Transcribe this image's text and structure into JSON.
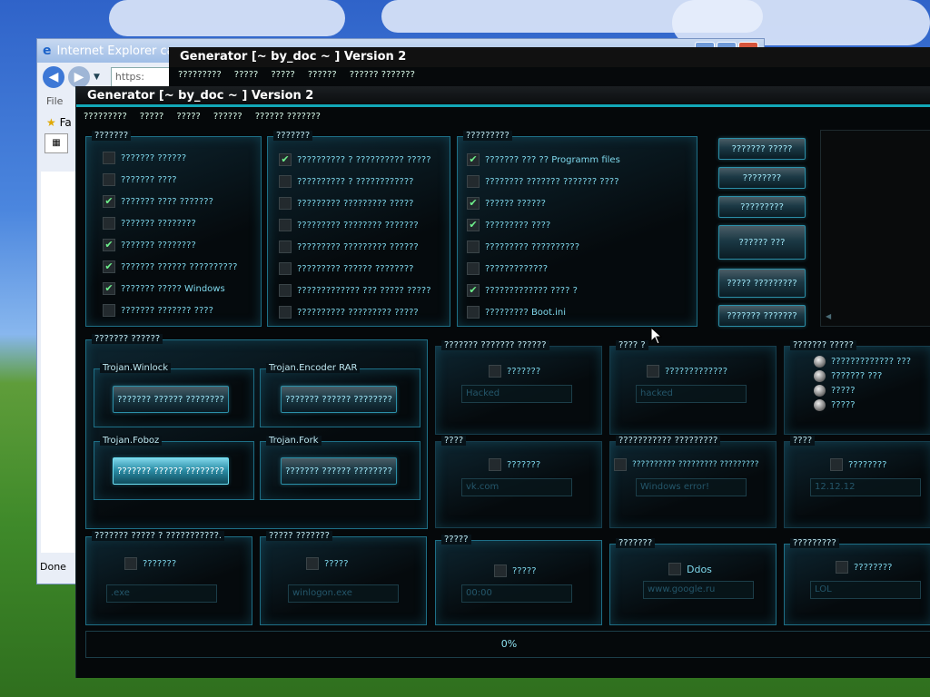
{
  "ie": {
    "title": "Internet Explorer ca",
    "address": "https:",
    "menu_file": "File",
    "favorites": "Fa",
    "status": "Done"
  },
  "gen_back": {
    "title": "Generator [~ by_doc ~ ] Version 2",
    "menu": [
      "?????????",
      "?????",
      "?????",
      "??????",
      "?????? ???????"
    ]
  },
  "gen": {
    "title": "Generator [~ by_doc ~ ] Version 2",
    "menu": [
      "?????????",
      "?????",
      "?????",
      "??????",
      "?????? ???????"
    ],
    "group1": {
      "label": "???????",
      "items": [
        {
          "label": "??????? ??????",
          "checked": false
        },
        {
          "label": "??????? ????",
          "checked": false
        },
        {
          "label": "??????? ???? ???????",
          "checked": true
        },
        {
          "label": "??????? ????????",
          "checked": false
        },
        {
          "label": "??????? ????????",
          "checked": true
        },
        {
          "label": "??????? ?????? ??????????",
          "checked": true
        },
        {
          "label": "??????? ????? Windows",
          "checked": true
        },
        {
          "label": "??????? ??????? ????",
          "checked": false
        }
      ]
    },
    "group2": {
      "label": "???????",
      "items": [
        {
          "label": "?????????? ? ?????????? ?????",
          "checked": true
        },
        {
          "label": "?????????? ? ????????????",
          "checked": false
        },
        {
          "label": "????????? ????????? ?????",
          "checked": false
        },
        {
          "label": "????????? ???????? ???????",
          "checked": false
        },
        {
          "label": "????????? ????????? ??????",
          "checked": false
        },
        {
          "label": "????????? ?????? ????????",
          "checked": false
        },
        {
          "label": "????????????? ??? ????? ?????",
          "checked": false
        },
        {
          "label": "?????????? ????????? ?????",
          "checked": false
        }
      ]
    },
    "group3": {
      "label": "?????????",
      "items": [
        {
          "label": "??????? ??? ?? Programm files",
          "checked": true
        },
        {
          "label": "???????? ??????? ??????? ????",
          "checked": false
        },
        {
          "label": "?????? ??????",
          "checked": true
        },
        {
          "label": "????????? ????",
          "checked": true
        },
        {
          "label": "????????? ??????????",
          "checked": false
        },
        {
          "label": "?????????????",
          "checked": false
        },
        {
          "label": "????????????? ???? ?",
          "checked": true
        },
        {
          "label": "????????? Boot.ini",
          "checked": false
        }
      ]
    },
    "side_buttons": [
      "??????? ?????",
      "????????",
      "?????????",
      "?????? ???",
      "????? ?????????",
      "??????? ???????"
    ],
    "trojans": {
      "label": "??????? ??????",
      "items": [
        {
          "name": "Trojan.Winlock",
          "button": "??????? ?????? ????????"
        },
        {
          "name": "Trojan.Encoder RAR",
          "button": "??????? ?????? ????????"
        },
        {
          "name": "Trojan.Foboz",
          "button": "??????? ?????? ????????"
        },
        {
          "name": "Trojan.Fork",
          "button": "??????? ?????? ????????"
        }
      ]
    },
    "opt_a": {
      "label": "??????? ??????? ??????",
      "check": "???????",
      "value": "Hacked"
    },
    "opt_b": {
      "label": "???? ?",
      "check": "?????????????",
      "value": "hacked"
    },
    "opt_c": {
      "label": "??????? ?????",
      "radios": [
        "????????????? ???",
        "??????? ???",
        "?????",
        "?????"
      ]
    },
    "opt_d": {
      "label": "????",
      "check": "???????",
      "value": "vk.com"
    },
    "opt_e": {
      "label": "??????????? ?????????",
      "check": "?????????? ????????? ?????????",
      "value": "Windows error!"
    },
    "opt_f": {
      "label": "????",
      "check": "????????",
      "value": "12.12.12"
    },
    "opt_g": {
      "label": "??????? ????? ? ???????????.",
      "check": "???????",
      "value": ".exe"
    },
    "opt_h": {
      "label": "????? ???????",
      "check": "?????",
      "value": "winlogon.exe"
    },
    "opt_i": {
      "label": "?????",
      "check": "?????",
      "value": "00:00"
    },
    "opt_j": {
      "label": "???????",
      "check": "Ddos",
      "value": "www.google.ru"
    },
    "opt_k": {
      "label": "?????????",
      "check": "????????",
      "value": "LOL"
    },
    "progress": "0%"
  },
  "colors": {
    "accent": "#12a8b8",
    "text": "#7fd8ec",
    "check": "#6ef08c"
  }
}
